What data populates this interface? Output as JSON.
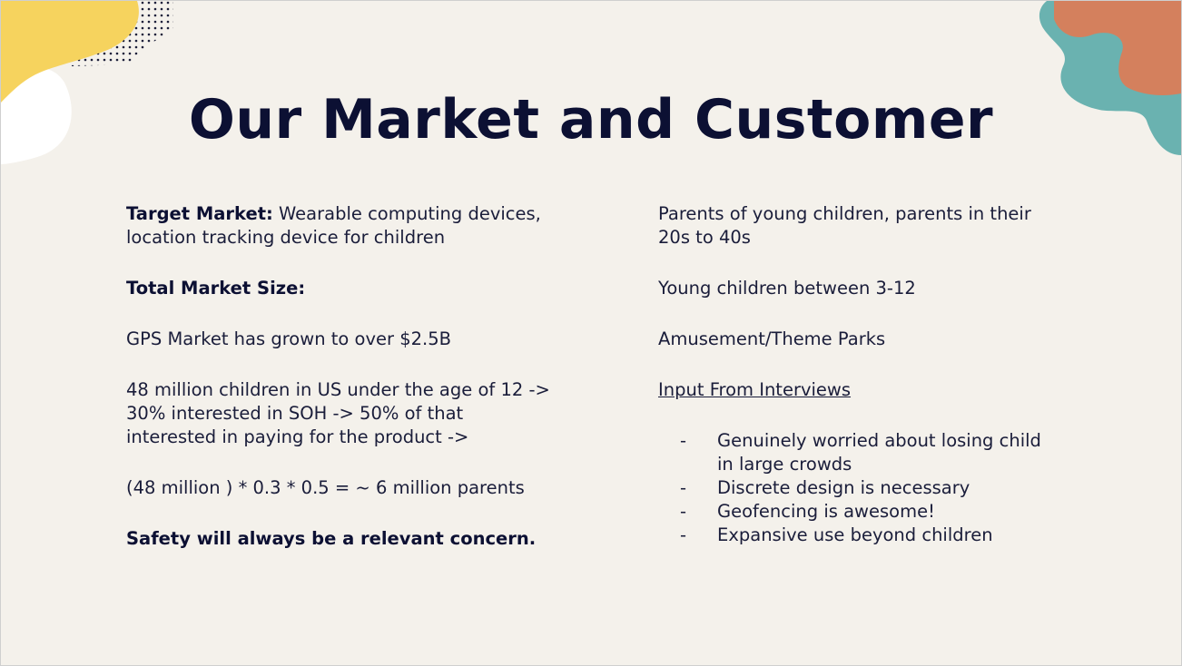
{
  "title": "Our Market and Customer",
  "left": {
    "target_label": "Target Market:",
    "target_text": " Wearable computing devices, location tracking device for children",
    "total_market_size": "Total Market Size:",
    "gps_market": "GPS Market has grown to over $2.5B",
    "children_stat": "48 million children in US under the age of 12 -> 30% interested in SOH -> 50% of that interested in paying for the product ->",
    "calculation": "(48 million ) * 0.3 * 0.5 = ~ 6 million parents",
    "safety": "Safety will always be a relevant concern."
  },
  "right": {
    "parents": "Parents of young children, parents in their 20s to 40s",
    "young_children": "Young children between 3-12",
    "parks": "Amusement/Theme Parks",
    "interviews_heading": "Input From Interviews",
    "bullet_marker": "-",
    "bullets": [
      "Genuinely worried about losing child in large crowds",
      "Discrete design is necessary",
      "Geofencing is awesome!",
      "Expansive use beyond children"
    ]
  },
  "colors": {
    "background": "#f4f1eb",
    "title": "#0c1033",
    "yellow_blob": "#f6d35e",
    "teal_blob": "#6ab2b0",
    "orange_blob": "#d4805d"
  }
}
